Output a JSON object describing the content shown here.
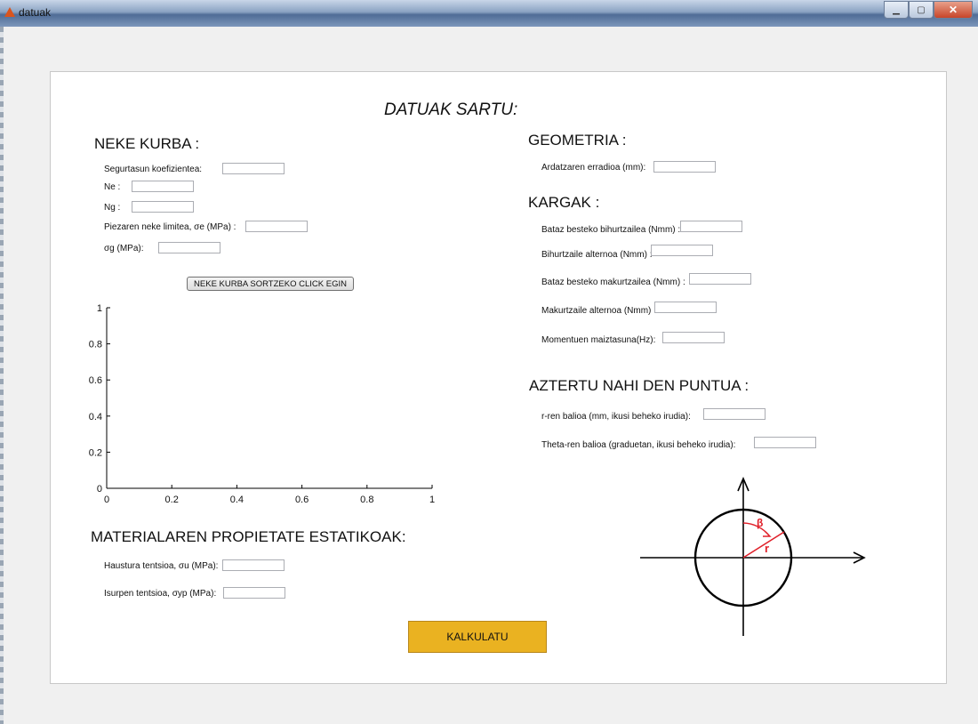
{
  "window": {
    "title": "datuak"
  },
  "form": {
    "title": "DATUAK SARTU:",
    "neke": {
      "heading": "NEKE KURBA :",
      "segurtasun_label": "Segurtasun koefizientea:",
      "ne_label": "Ne :",
      "ng_label": "Ng :",
      "piezaren_label": "Piezaren neke limitea, σe (MPa) :",
      "sigma_g_label": "σg (MPa):",
      "button": "NEKE KURBA SORTZEKO CLICK EGIN"
    },
    "material": {
      "heading": "MATERIALAREN PROPIETATE ESTATIKOAK:",
      "haustura_label": "Haustura tentsioa, σu (MPa):",
      "isurpen_label": "Isurpen tentsioa, σyp (MPa):"
    },
    "geometria": {
      "heading": "GEOMETRIA :",
      "ardatzaren_label": "Ardatzaren erradioa (mm):"
    },
    "kargak": {
      "heading": "KARGAK :",
      "bataz_bihurtzailea_label": "Bataz besteko bihurtzailea (Nmm) :",
      "bihurtzaile_alternoa_label": "Bihurtzaile alternoa (Nmm) :",
      "bataz_makurtzailea_label": "Bataz besteko makurtzailea (Nmm) :",
      "makurtzaile_alternoa_label": "Makurtzaile alternoa (Nmm) :",
      "maiztasuna_label": "Momentuen maiztasuna(Hz):"
    },
    "puntua": {
      "heading": "AZTERTU NAHI DEN PUNTUA :",
      "r_label": "r-ren balioa (mm, ikusi beheko irudia):",
      "theta_label": "Theta-ren balioa (graduetan, ikusi beheko irudia):"
    },
    "calculate_button": "KALKULATU"
  },
  "diagram": {
    "beta_label": "β",
    "r_label": "r"
  },
  "chart_data": {
    "type": "line",
    "series": [],
    "xlim": [
      0,
      1
    ],
    "ylim": [
      0,
      1
    ],
    "xticks": [
      "0",
      "0.2",
      "0.4",
      "0.6",
      "0.8",
      "1"
    ],
    "yticks": [
      "0",
      "0.2",
      "0.4",
      "0.6",
      "0.8",
      "1"
    ],
    "grid": false
  },
  "colors": {
    "calculate_button": "#eab221",
    "diagram_accent": "#e0202a"
  }
}
